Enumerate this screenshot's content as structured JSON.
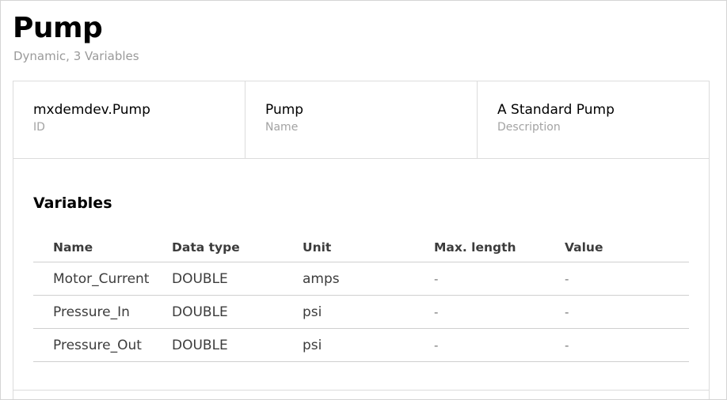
{
  "header": {
    "title": "Pump",
    "subtitle": "Dynamic, 3 Variables"
  },
  "properties": [
    {
      "value": "mxdemdev.Pump",
      "label": "ID"
    },
    {
      "value": "Pump",
      "label": "Name"
    },
    {
      "value": "A Standard Pump",
      "label": "Description"
    }
  ],
  "variables": {
    "title": "Variables",
    "columns": [
      "Name",
      "Data type",
      "Unit",
      "Max. length",
      "Value"
    ],
    "rows": [
      [
        "Motor_Current",
        "DOUBLE",
        "amps",
        "-",
        "-"
      ],
      [
        "Pressure_In",
        "DOUBLE",
        "psi",
        "-",
        "-"
      ],
      [
        "Pressure_Out",
        "DOUBLE",
        "psi",
        "-",
        "-"
      ]
    ]
  }
}
